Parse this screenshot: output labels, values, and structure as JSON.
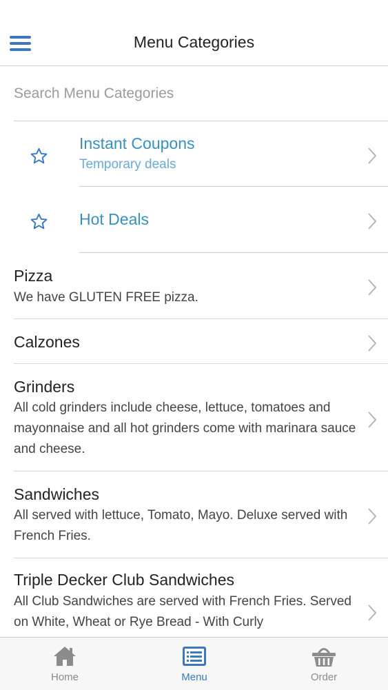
{
  "header": {
    "title": "Menu Categories",
    "menu_icon": "hamburger-menu-icon"
  },
  "search": {
    "placeholder": "Search Menu Categories",
    "value": ""
  },
  "featured": [
    {
      "title": "Instant Coupons",
      "subtitle": "Temporary deals",
      "icon": "star-outline-icon"
    },
    {
      "title": "Hot Deals",
      "icon": "star-outline-icon"
    }
  ],
  "categories": [
    {
      "title": "Pizza",
      "description": "We have GLUTEN FREE pizza."
    },
    {
      "title": "Calzones",
      "description": ""
    },
    {
      "title": "Grinders",
      "description": "All cold grinders include cheese, lettuce, tomatoes and mayonnaise and all hot grinders come with marinara sauce and cheese."
    },
    {
      "title": "Sandwiches",
      "description": "All served with lettuce, Tomato, Mayo. Deluxe served with French Fries."
    },
    {
      "title": "Triple Decker Club Sandwiches",
      "description": "All Club Sandwiches are served with French Fries. Served on White, Wheat or Rye Bread - With Curly"
    }
  ],
  "tabs": [
    {
      "label": "Home",
      "icon": "home-icon",
      "active": false
    },
    {
      "label": "Menu",
      "icon": "menu-list-icon",
      "active": true
    },
    {
      "label": "Order",
      "icon": "basket-icon",
      "active": false
    }
  ],
  "colors": {
    "accent": "#3a78c3",
    "link": "#3a8fc0",
    "subtle_link": "#6aaad3",
    "separator": "#cfcfcf",
    "tab_inactive": "#8a8a8a"
  }
}
